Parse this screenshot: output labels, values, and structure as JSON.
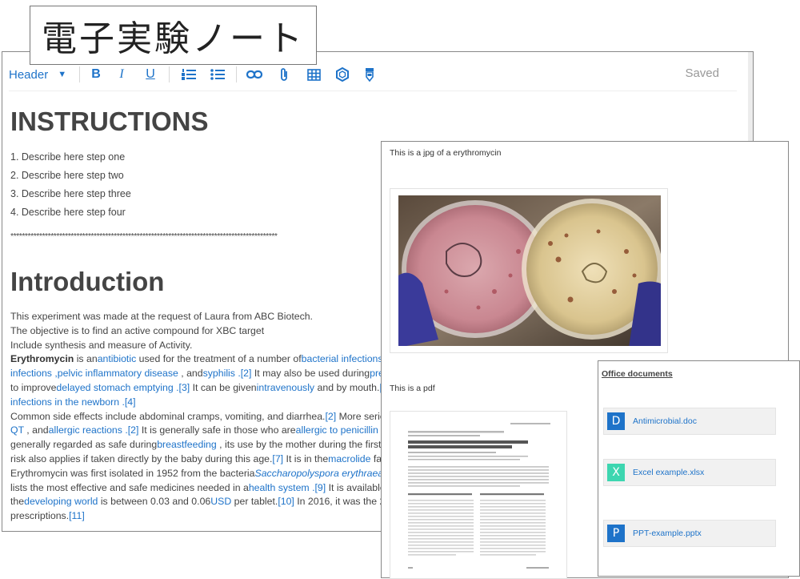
{
  "title_overlay": "電子実験ノート",
  "toolbar": {
    "header_label": "Header",
    "bold": "B",
    "italic": "I",
    "underline": "U",
    "saved": "Saved"
  },
  "content": {
    "h_instructions": "INSTRUCTIONS",
    "steps": [
      "Describe here step one",
      "Describe here step two",
      "Describe here step three",
      "Describe here step four"
    ],
    "stars": "*********************************************************************************************",
    "h_intro": "Introduction",
    "intro_lines": [
      "This experiment was made at the request of Laura from ABC Biotech.",
      "The objective is to find an active compound for XBC target",
      "Include synthesis and measure of Activity."
    ],
    "l1": {
      "bold": "Erythromycin",
      "t1": " is an",
      "a1": "antibiotic",
      "t2": "  used for the treatment of a number of",
      "a2": "bacterial infections"
    },
    "l2": {
      "a1": "infections",
      "a2": " ,pelvic inflammatory disease",
      "t1": "  , and",
      "a3": "syphilis",
      "c1": " .[2]",
      "t2": "  It may also be used during",
      "a4": "pre"
    },
    "l3": {
      "t1": "to improve",
      "a1": "delayed stomach emptying",
      "c1": " .[3]",
      "t2": "  It can be given",
      "a2": "intravenously",
      "t3": "  and by mouth.",
      "c2": "["
    },
    "l4": {
      "a1": "infections in the newborn",
      "c1": " .[4]"
    },
    "l5": {
      "t1": "Common side effects include abdominal cramps, vomiting, and diarrhea.",
      "c1": "[2]",
      "t2": "  More seriou"
    },
    "l6": {
      "a1": "QT",
      "t1": "  , and",
      "a2": "allergic reactions",
      "c1": " .[2]",
      "t2": "  It is generally safe in those who are",
      "a3": "allergic to penicillin"
    },
    "l7": {
      "t1": "generally regarded as safe during",
      "a1": "breastfeeding",
      "t2": "  , its use by the mother during the first t"
    },
    "l8": {
      "t1": "risk also applies if taken directly by the baby during this age.",
      "c1": "[7]",
      "t2": "  It is in the",
      "a1": "macrolide",
      "t3": "  fan"
    },
    "l9": {
      "t1": "Erythromycin was first isolated in 1952 from the bacteria",
      "a1": "Saccharopolyspora erythraea"
    },
    "l10": {
      "t1": "lists the most effective and safe medicines needed in a",
      "a1": "health system",
      "c1": " .[9]",
      "t2": "  It is available"
    },
    "l11": {
      "t1": "the",
      "a1": "developing world",
      "t2": "  is between 0.03 and 0.06",
      "a2": "USD",
      "t3": "  per tablet.",
      "c1": "[10]",
      "t4": "  In 2016, it was the 2"
    },
    "l12": {
      "t1": "prescriptions.",
      "c1": "[11]"
    }
  },
  "image_panel": {
    "jpg_caption": "This is a jpg of a erythromycin",
    "pdf_caption": "This is a pdf"
  },
  "office": {
    "title": "Office documents",
    "files": [
      {
        "letter": "D",
        "name": "Antimicrobial.doc",
        "color": "#1e73c9"
      },
      {
        "letter": "X",
        "name": "Excel example.xlsx",
        "color": "#3dd6b0"
      },
      {
        "letter": "P",
        "name": "PPT-example.pptx",
        "color": "#1e73c9"
      }
    ]
  },
  "colors": {
    "link": "#1e73c9",
    "border": "#888888"
  }
}
